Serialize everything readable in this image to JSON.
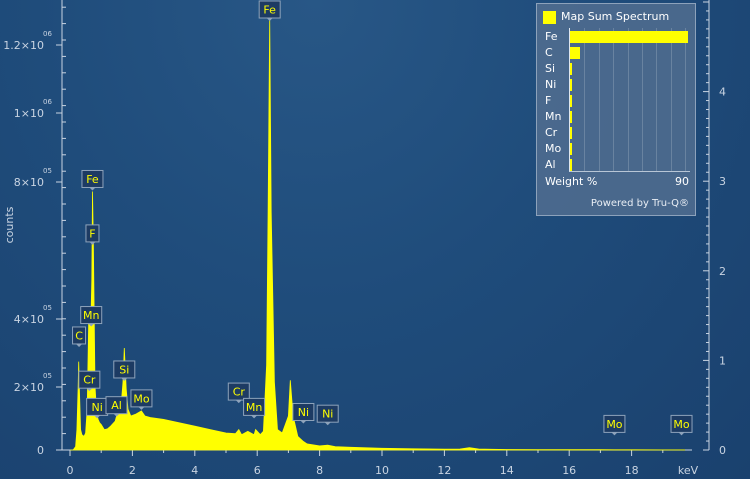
{
  "chart_data": {
    "type": "area",
    "title": "",
    "xlabel": "keV",
    "ylabel": "counts",
    "xlim": [
      0,
      19.7
    ],
    "ylim": [
      0,
      1300000
    ],
    "x_ticks": [
      0,
      2,
      4,
      6,
      8,
      10,
      12,
      14,
      16,
      18
    ],
    "y_tick_labels": [
      {
        "value": 0,
        "mantissa": "0",
        "exp": ""
      },
      {
        "value": 200000,
        "mantissa": "2×10",
        "exp": "05"
      },
      {
        "value": 400000,
        "mantissa": "4×10",
        "exp": "05"
      },
      {
        "value": 800000,
        "mantissa": "8×10",
        "exp": "05"
      },
      {
        "value": 1000000,
        "mantissa": "1×10",
        "exp": "06"
      },
      {
        "value": 1200000,
        "mantissa": "1.2×10",
        "exp": "06"
      }
    ],
    "right_axis": {
      "ylim": [
        0,
        5
      ],
      "ticks": [
        0,
        1,
        2,
        3,
        4
      ]
    },
    "series": [
      {
        "color": "#ffff00",
        "x": [
          0,
          0.1,
          0.18,
          0.22,
          0.26,
          0.28,
          0.3,
          0.34,
          0.38,
          0.45,
          0.5,
          0.55,
          0.6,
          0.64,
          0.67,
          0.7,
          0.72,
          0.75,
          0.8,
          0.85,
          0.9,
          0.95,
          1.0,
          1.1,
          1.2,
          1.3,
          1.45,
          1.55,
          1.65,
          1.7,
          1.74,
          1.8,
          1.86,
          1.95,
          2.1,
          2.29,
          2.4,
          2.6,
          3.0,
          3.5,
          4.0,
          4.5,
          5.0,
          5.3,
          5.41,
          5.5,
          5.7,
          5.9,
          5.95,
          6.1,
          6.2,
          6.3,
          6.35,
          6.4,
          6.45,
          6.55,
          6.65,
          6.8,
          7.0,
          7.06,
          7.15,
          7.3,
          7.48,
          7.6,
          8.0,
          8.26,
          8.5,
          9.0,
          10.0,
          11.0,
          12.0,
          12.5,
          12.8,
          13.1,
          13.5,
          14.0,
          15.0,
          16.0,
          17.0,
          17.45,
          18.0,
          19.0,
          19.7
        ],
        "y": [
          0,
          0,
          10000,
          60000,
          180000,
          260000,
          180000,
          60000,
          45000,
          40000,
          50000,
          120000,
          380000,
          420000,
          380000,
          500000,
          760000,
          600000,
          190000,
          110000,
          90000,
          80000,
          75000,
          60000,
          62000,
          70000,
          85000,
          120000,
          145000,
          200000,
          300000,
          180000,
          120000,
          100000,
          105000,
          115000,
          100000,
          95000,
          90000,
          80000,
          70000,
          60000,
          50000,
          48000,
          60000,
          45000,
          55000,
          45000,
          60000,
          45000,
          55000,
          250000,
          700000,
          1270000,
          700000,
          200000,
          60000,
          50000,
          100000,
          205000,
          100000,
          40000,
          25000,
          18000,
          12000,
          14000,
          10000,
          8000,
          5000,
          3500,
          2500,
          3000,
          7000,
          3000,
          2000,
          1500,
          1200,
          1000,
          800,
          700,
          600,
          400,
          300
        ]
      }
    ],
    "annotations": [
      {
        "label": "Fe",
        "x": 6.4,
        "y": 1270000
      },
      {
        "label": "Fe",
        "x": 0.72,
        "y": 760000
      },
      {
        "label": "F",
        "x": 0.72,
        "y": 600000
      },
      {
        "label": "Mn",
        "x": 0.68,
        "y": 360000
      },
      {
        "label": "C",
        "x": 0.29,
        "y": 300000
      },
      {
        "label": "Cr",
        "x": 0.62,
        "y": 170000
      },
      {
        "label": "Ni",
        "x": 0.87,
        "y": 90000
      },
      {
        "label": "Al",
        "x": 1.49,
        "y": 95000
      },
      {
        "label": "Si",
        "x": 1.74,
        "y": 200000
      },
      {
        "label": "Mo",
        "x": 2.29,
        "y": 115000
      },
      {
        "label": "Cr",
        "x": 5.41,
        "y": 135000
      },
      {
        "label": "Mn",
        "x": 5.9,
        "y": 90000
      },
      {
        "label": "Ni",
        "x": 7.48,
        "y": 75000
      },
      {
        "label": "Ni",
        "x": 8.26,
        "y": 70000
      },
      {
        "label": "Mo",
        "x": 17.45,
        "y": 40000
      },
      {
        "label": "Mo",
        "x": 19.6,
        "y": 40000
      }
    ]
  },
  "legend": {
    "title": "Map Sum Spectrum",
    "weight_label": "Weight %",
    "weight_max": 90,
    "powered_by": "Powered by Tru-Q®",
    "elements": [
      {
        "symbol": "Fe",
        "weight": 88.5
      },
      {
        "symbol": "C",
        "weight": 7.5
      },
      {
        "symbol": "Si",
        "weight": 1.2
      },
      {
        "symbol": "Ni",
        "weight": 0.9
      },
      {
        "symbol": "F",
        "weight": 0.9
      },
      {
        "symbol": "Mn",
        "weight": 0.6
      },
      {
        "symbol": "Cr",
        "weight": 0.5
      },
      {
        "symbol": "Mo",
        "weight": 0.4
      },
      {
        "symbol": "Al",
        "weight": 0.3
      }
    ]
  }
}
